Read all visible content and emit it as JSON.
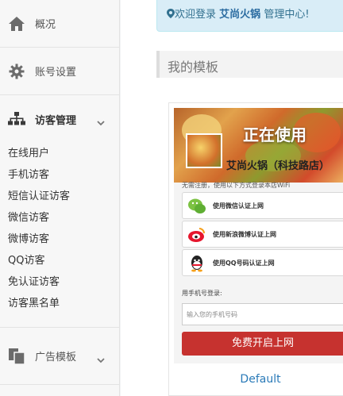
{
  "sidebar": {
    "overview": {
      "label": "概况",
      "icon": "home-icon"
    },
    "account": {
      "label": "账号设置",
      "icon": "gear-icon"
    },
    "visitors": {
      "label": "访客管理",
      "icon": "sitemap-icon",
      "items": [
        "在线用户",
        "手机访客",
        "短信认证访客",
        "微信访客",
        "微博访客",
        "QQ访客",
        "免认证访客",
        "访客黑名单"
      ]
    },
    "ads": {
      "label": "广告模板",
      "icon": "copy-icon"
    }
  },
  "header": {
    "welcome_prefix": "欢迎登录",
    "brand": "艾尚火锅",
    "welcome_suffix": "管理中心!"
  },
  "section_title": "我的模板",
  "template_card": {
    "status": "正在使用",
    "shop_name": "艾尚火锅（科技路店）",
    "hint": "无需注册，使用以下方式登录本店WiFi",
    "options": [
      {
        "label": "使用微信认证上网",
        "icon": "wechat-icon"
      },
      {
        "label": "使用新浪微博认证上网",
        "icon": "weibo-icon"
      },
      {
        "label": "使用QQ号码认证上网",
        "icon": "qq-icon"
      }
    ],
    "phone_label": "用手机号登录:",
    "phone_placeholder": "输入您的手机号码",
    "submit_label": "免费开启上网",
    "name": "Default"
  },
  "colors": {
    "accent": "#2a7ab8",
    "button": "#c6322f",
    "welcome_bg": "#d9edf7"
  }
}
